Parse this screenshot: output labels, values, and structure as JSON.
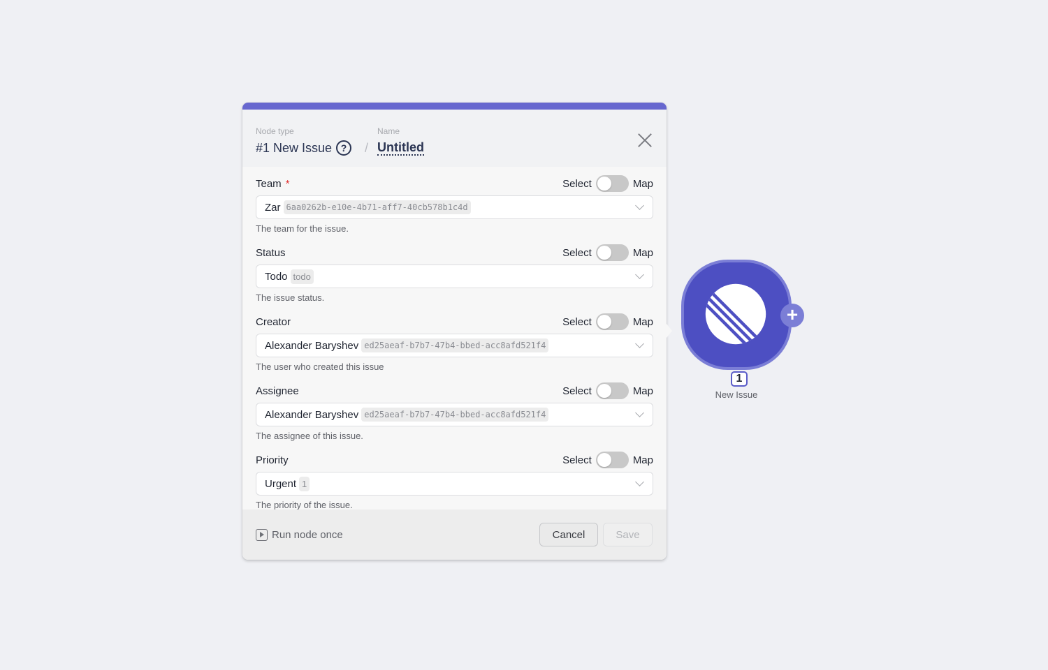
{
  "header": {
    "node_type_label": "Node type",
    "node_type_value": "#1 New Issue",
    "separator": "/",
    "name_label": "Name",
    "name_value": "Untitled",
    "help_icon": "?"
  },
  "colors": {
    "accent": "#6767cf",
    "node": "#4d4fc2",
    "required": "#e03030"
  },
  "fields": [
    {
      "label": "Team",
      "required": "*",
      "toggle_left": "Select",
      "toggle_right": "Map",
      "value": "Zar",
      "id": "6aa0262b-e10e-4b71-aff7-40cb578b1c4d",
      "hint": "The team for the issue."
    },
    {
      "label": "Status",
      "toggle_left": "Select",
      "toggle_right": "Map",
      "value": "Todo",
      "id": "todo",
      "hint": "The issue status."
    },
    {
      "label": "Creator",
      "toggle_left": "Select",
      "toggle_right": "Map",
      "value": "Alexander Baryshev",
      "id": "ed25aeaf-b7b7-47b4-bbed-acc8afd521f4",
      "hint": "The user who created this issue"
    },
    {
      "label": "Assignee",
      "toggle_left": "Select",
      "toggle_right": "Map",
      "value": "Alexander Baryshev",
      "id": "ed25aeaf-b7b7-47b4-bbed-acc8afd521f4",
      "hint": "The assignee of this issue."
    },
    {
      "label": "Priority",
      "toggle_left": "Select",
      "toggle_right": "Map",
      "value": "Urgent",
      "id": "1",
      "hint": "The priority of the issue."
    }
  ],
  "footer": {
    "run_once": "Run node once",
    "cancel": "Cancel",
    "save": "Save"
  },
  "node": {
    "badge": "1",
    "label": "New Issue",
    "add": "+"
  }
}
